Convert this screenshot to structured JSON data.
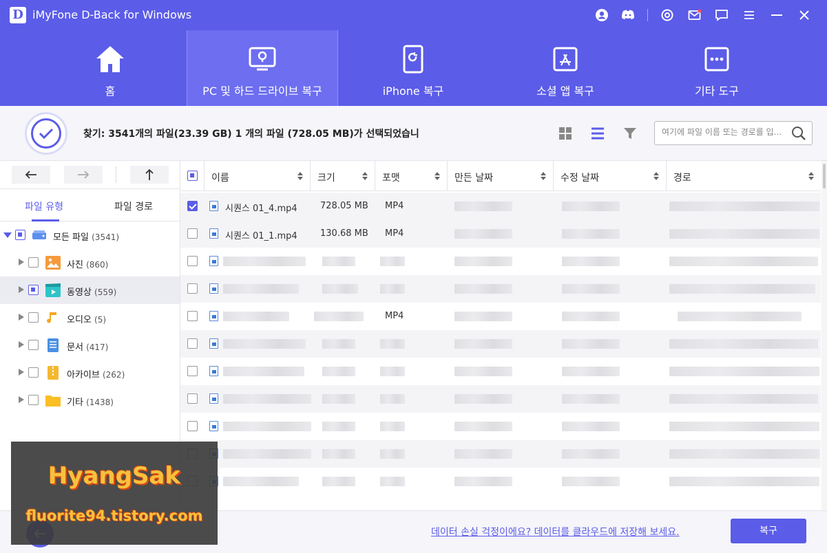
{
  "window": {
    "logo_letter": "D",
    "title": "iMyFone D-Back for Windows"
  },
  "nav": {
    "items": [
      {
        "label": "홈",
        "icon": "home-icon"
      },
      {
        "label": "PC 및 하드 드라이브 복구",
        "icon": "pc-drive-icon",
        "active": true
      },
      {
        "label": "iPhone 복구",
        "icon": "iphone-icon"
      },
      {
        "label": "소셜 앱 복구",
        "icon": "appstore-icon"
      },
      {
        "label": "기타 도구",
        "icon": "more-tools-icon"
      }
    ]
  },
  "status": {
    "text": "찾기: 3541개의 파일(23.39 GB) 1 개의 파일 (728.05 MB)가 선택되었습니"
  },
  "search": {
    "placeholder": "여기에 파일 이름 또는 경로를 입..."
  },
  "left_panel": {
    "tabs": [
      "파일 유형",
      "파일 경로"
    ],
    "tree": [
      {
        "label": "모든 파일",
        "count": "(3541)"
      },
      {
        "label": "사진",
        "count": "(860)"
      },
      {
        "label": "동영상",
        "count": "(559)"
      },
      {
        "label": "오디오",
        "count": "(5)"
      },
      {
        "label": "문서",
        "count": "(417)"
      },
      {
        "label": "아카이브",
        "count": "(262)"
      },
      {
        "label": "기타",
        "count": "(1438)"
      }
    ]
  },
  "table": {
    "columns": [
      "이름",
      "크기",
      "포맷",
      "만든 날짜",
      "수정 날짜",
      "경로"
    ],
    "rows": [
      {
        "name": "시퀀스 01_4.mp4",
        "size": "728.05 MB",
        "format": "MP4",
        "checked": true
      },
      {
        "name": "시퀀스 01_1.mp4",
        "size": "130.68 MB",
        "format": "MP4",
        "checked": false
      }
    ],
    "hidden_row_formats": [
      "",
      "",
      "MP4",
      "",
      "",
      "",
      "",
      "",
      ""
    ]
  },
  "footer": {
    "cloud_link": "데이터 손실 걱정이에요? 데이터를 클라우드에 저장해 보세요.",
    "recover_label": "복구"
  },
  "watermark": {
    "title": "HyangSak",
    "url": "fluorite94.tistory.com"
  },
  "colors": {
    "accent": "#5b5ce8",
    "nav_active": "#6d6ef0",
    "watermark_text": "#f6c23e"
  }
}
